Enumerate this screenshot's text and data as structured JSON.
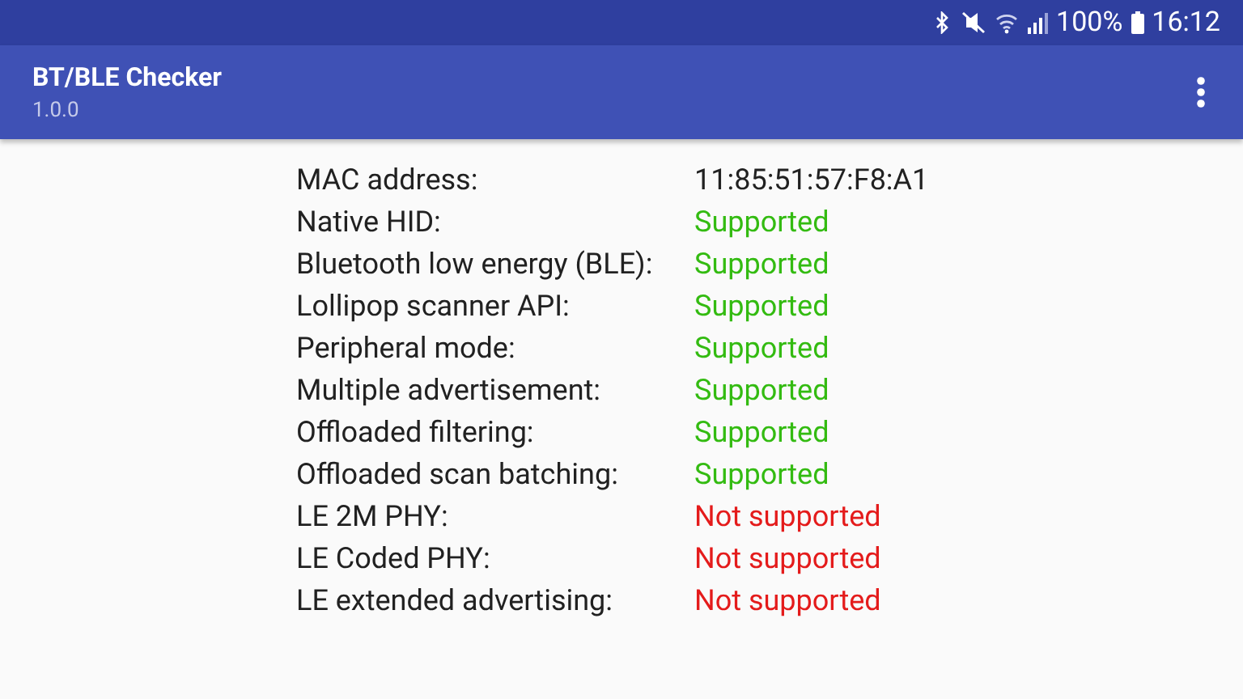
{
  "status_bar": {
    "battery": "100%",
    "time": "16:12"
  },
  "app_bar": {
    "title": "BT/BLE Checker",
    "subtitle": "1.0.0"
  },
  "rows": [
    {
      "label": "MAC address:",
      "value": "11:85:51:57:F8:A1",
      "kind": "plain"
    },
    {
      "label": "Native HID:",
      "value": "Supported",
      "kind": "supported"
    },
    {
      "label": "Bluetooth low energy (BLE):",
      "value": "Supported",
      "kind": "supported"
    },
    {
      "label": "Lollipop scanner API:",
      "value": "Supported",
      "kind": "supported"
    },
    {
      "label": "Peripheral mode:",
      "value": "Supported",
      "kind": "supported"
    },
    {
      "label": "Multiple advertisement:",
      "value": "Supported",
      "kind": "supported"
    },
    {
      "label": "Offloaded filtering:",
      "value": "Supported",
      "kind": "supported"
    },
    {
      "label": "Offloaded scan batching:",
      "value": "Supported",
      "kind": "supported"
    },
    {
      "label": "LE 2M PHY:",
      "value": "Not supported",
      "kind": "unsupported"
    },
    {
      "label": "LE Coded PHY:",
      "value": "Not supported",
      "kind": "unsupported"
    },
    {
      "label": "LE extended advertising:",
      "value": "Not supported",
      "kind": "unsupported"
    }
  ]
}
